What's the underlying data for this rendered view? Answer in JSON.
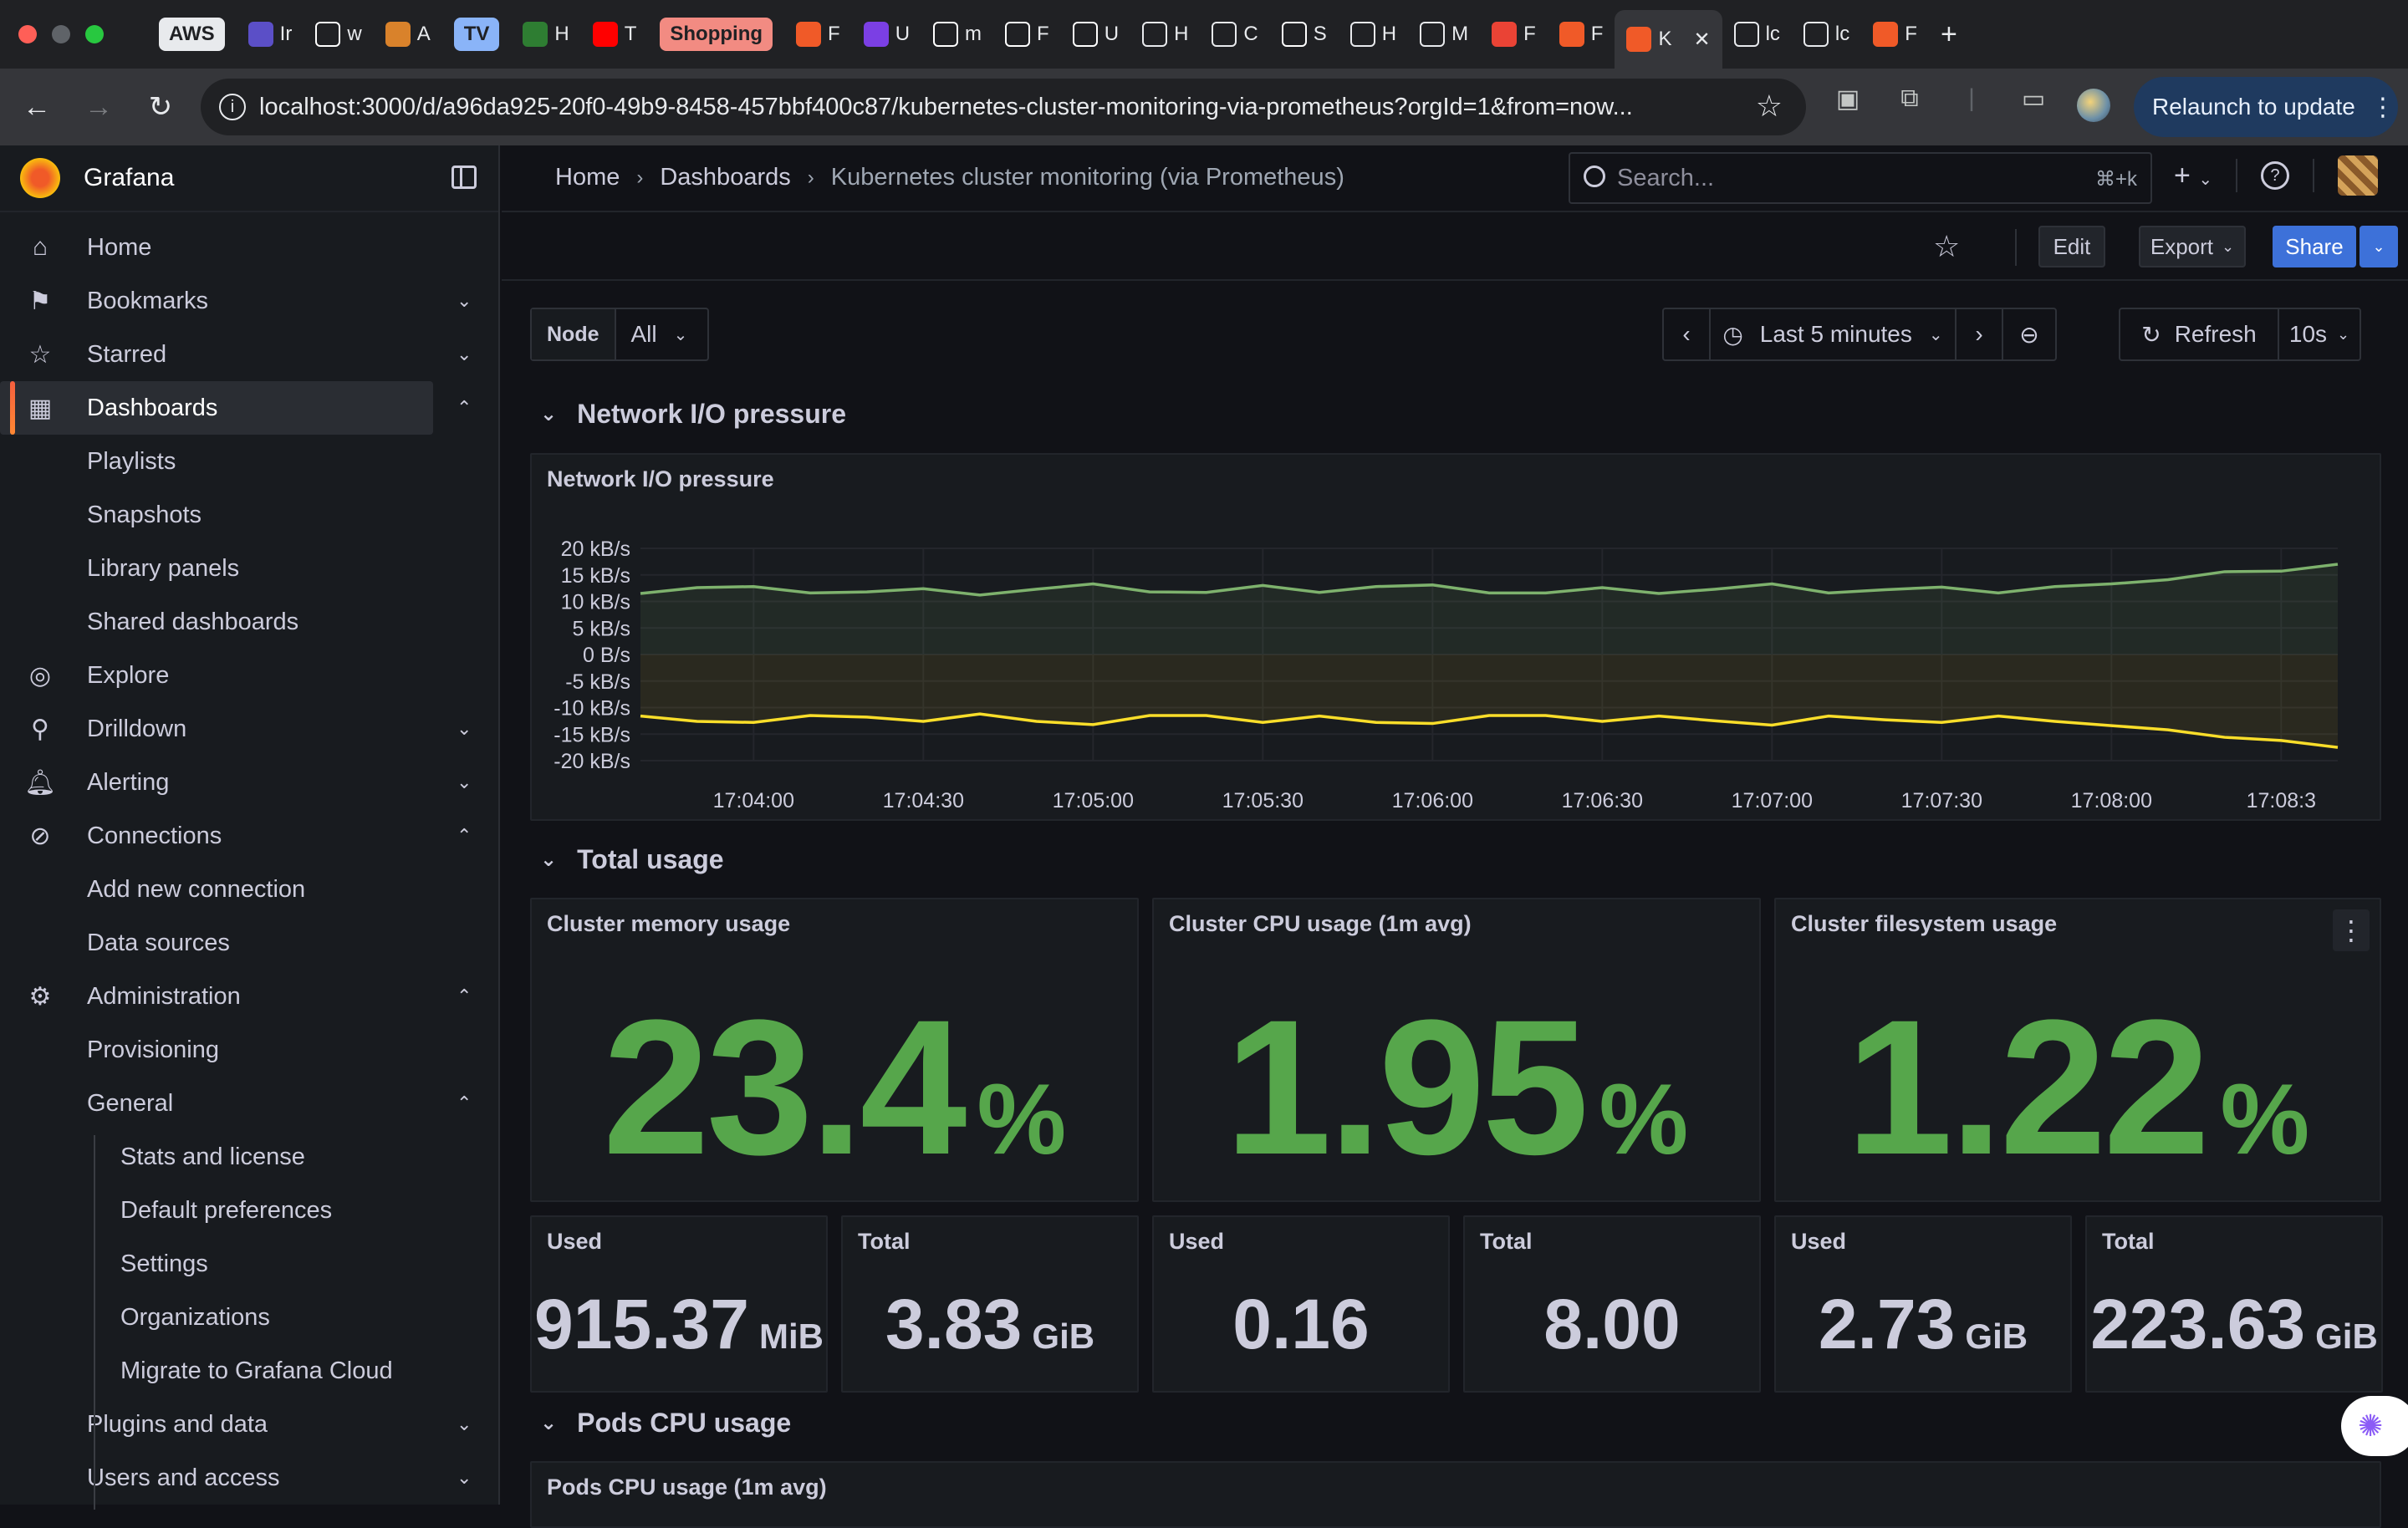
{
  "browser": {
    "tabs": [
      {
        "label": "AWS",
        "kind": "pill",
        "bg": "#e8eaed",
        "fg": "#202124"
      },
      {
        "label": "Ir",
        "icon": "terminal-icon",
        "color": "#5b4fc7"
      },
      {
        "label": "w",
        "icon": "github-icon",
        "color": "#ffffff"
      },
      {
        "label": "A",
        "icon": "app-icon",
        "color": "#d9822b"
      },
      {
        "label": "TV",
        "kind": "pill",
        "bg": "#8ab4f8",
        "fg": "#202124"
      },
      {
        "label": "H",
        "icon": "k-icon",
        "color": "#2e7d32"
      },
      {
        "label": "T",
        "icon": "youtube-icon",
        "color": "#ff0000"
      },
      {
        "label": "Shopping",
        "kind": "pill",
        "bg": "#f28b82",
        "fg": "#202124"
      },
      {
        "label": "F",
        "icon": "gear-icon",
        "color": "#f05a28"
      },
      {
        "label": "U",
        "icon": "u-icon",
        "color": "#7b3fe4"
      },
      {
        "label": "m",
        "icon": "fsu-icon",
        "color": "#ffffff"
      },
      {
        "label": "F",
        "icon": "circle-icon",
        "color": "#ffffff"
      },
      {
        "label": "U",
        "icon": "fsu-icon",
        "color": "#ffffff"
      },
      {
        "label": "H",
        "icon": "globe-icon",
        "color": "#e8eaed"
      },
      {
        "label": "C",
        "icon": "globe-icon",
        "color": "#e8eaed"
      },
      {
        "label": "S",
        "icon": "fsu-icon",
        "color": "#ffffff"
      },
      {
        "label": "H",
        "icon": "globe-icon",
        "color": "#e8eaed"
      },
      {
        "label": "M",
        "icon": "globe-icon",
        "color": "#e8eaed"
      },
      {
        "label": "F",
        "icon": "gmail-icon",
        "color": "#ea4335"
      },
      {
        "label": "F",
        "icon": "grafana-icon",
        "color": "#f05a28"
      },
      {
        "label": "K",
        "icon": "grafana-icon",
        "color": "#f05a28",
        "active": true
      },
      {
        "label": "lc",
        "icon": "globe-icon",
        "color": "#e8eaed"
      },
      {
        "label": "lc",
        "icon": "globe-icon",
        "color": "#e8eaed"
      },
      {
        "label": "F",
        "icon": "grafana-icon",
        "color": "#f05a28"
      }
    ],
    "url": "localhost:3000/d/a96da925-20f0-49b9-8458-457bbf400c87/kubernetes-cluster-monitoring-via-prometheus?orgId=1&from=now...",
    "relaunch_label": "Relaunch to update"
  },
  "sidebar": {
    "brand": "Grafana",
    "items": [
      {
        "label": "Home",
        "icon": "home-icon",
        "level": 0,
        "chev": ""
      },
      {
        "label": "Bookmarks",
        "icon": "bookmark-icon",
        "level": 0,
        "chev": "⌄"
      },
      {
        "label": "Starred",
        "icon": "star-icon",
        "level": 0,
        "chev": "⌄"
      },
      {
        "label": "Dashboards",
        "icon": "dashboards-icon",
        "level": 0,
        "chev": "⌃",
        "active": true
      },
      {
        "label": "Playlists",
        "level": 1
      },
      {
        "label": "Snapshots",
        "level": 1
      },
      {
        "label": "Library panels",
        "level": 1
      },
      {
        "label": "Shared dashboards",
        "level": 1
      },
      {
        "label": "Explore",
        "icon": "compass-icon",
        "level": 0,
        "chev": ""
      },
      {
        "label": "Drilldown",
        "icon": "drilldown-icon",
        "level": 0,
        "chev": "⌄"
      },
      {
        "label": "Alerting",
        "icon": "bell-icon",
        "level": 0,
        "chev": "⌄"
      },
      {
        "label": "Connections",
        "icon": "connections-icon",
        "level": 0,
        "chev": "⌃"
      },
      {
        "label": "Add new connection",
        "level": 1
      },
      {
        "label": "Data sources",
        "level": 1
      },
      {
        "label": "Administration",
        "icon": "cog-icon",
        "level": 0,
        "chev": "⌃"
      },
      {
        "label": "Provisioning",
        "level": 1
      },
      {
        "label": "General",
        "level": 1,
        "chev": "⌃"
      },
      {
        "label": "Stats and license",
        "level": 2
      },
      {
        "label": "Default preferences",
        "level": 2
      },
      {
        "label": "Settings",
        "level": 2
      },
      {
        "label": "Organizations",
        "level": 2
      },
      {
        "label": "Migrate to Grafana Cloud",
        "level": 2
      },
      {
        "label": "Plugins and data",
        "level": 1,
        "chev": "⌄"
      },
      {
        "label": "Users and access",
        "level": 1,
        "chev": "⌄"
      }
    ]
  },
  "header": {
    "breadcrumbs": [
      "Home",
      "Dashboards",
      "Kubernetes cluster monitoring (via Prometheus)"
    ],
    "search_placeholder": "Search...",
    "search_shortcut": "⌘+k"
  },
  "toolbar": {
    "edit": "Edit",
    "export": "Export",
    "share": "Share"
  },
  "variables": {
    "node_label": "Node",
    "node_value": "All"
  },
  "time": {
    "range": "Last 5 minutes",
    "refresh_label": "Refresh",
    "interval": "10s"
  },
  "rows": {
    "network": "Network I/O pressure",
    "total": "Total usage",
    "pods": "Pods CPU usage"
  },
  "panels": {
    "network_title": "Network I/O pressure",
    "memory_title": "Cluster memory usage",
    "memory_value": "23.4",
    "memory_unit": "%",
    "cpu_title": "Cluster CPU usage (1m avg)",
    "cpu_value": "1.95",
    "cpu_unit": "%",
    "fs_title": "Cluster filesystem usage",
    "fs_value": "1.22",
    "fs_unit": "%",
    "small": [
      {
        "title": "Used",
        "value": "915.37",
        "unit": "MiB"
      },
      {
        "title": "Total",
        "value": "3.83",
        "unit": "GiB"
      },
      {
        "title": "Used",
        "value": "0.16",
        "unit": ""
      },
      {
        "title": "Total",
        "value": "8.00",
        "unit": ""
      },
      {
        "title": "Used",
        "value": "2.73",
        "unit": "GiB"
      },
      {
        "title": "Total",
        "value": "223.63",
        "unit": "GiB"
      }
    ],
    "pods_title": "Pods CPU usage (1m avg)"
  },
  "colors": {
    "stat_green": "#56a64b",
    "rx_line": "#7eb26d",
    "tx_line": "#fade2a",
    "accent": "#3d71d9"
  },
  "chart_data": {
    "type": "line",
    "title": "Network I/O pressure",
    "x": [
      "17:03:40",
      "17:03:50",
      "17:04:00",
      "17:04:10",
      "17:04:20",
      "17:04:30",
      "17:04:40",
      "17:04:50",
      "17:05:00",
      "17:05:10",
      "17:05:20",
      "17:05:30",
      "17:05:40",
      "17:05:50",
      "17:06:00",
      "17:06:10",
      "17:06:20",
      "17:06:30",
      "17:06:40",
      "17:06:50",
      "17:07:00",
      "17:07:10",
      "17:07:20",
      "17:07:30",
      "17:07:40",
      "17:07:50",
      "17:08:00",
      "17:08:10",
      "17:08:20",
      "17:08:30",
      "17:08:40"
    ],
    "x_ticks": [
      "17:04:00",
      "17:04:30",
      "17:05:00",
      "17:05:30",
      "17:06:00",
      "17:06:30",
      "17:07:00",
      "17:07:30",
      "17:08:00",
      "17:08:3"
    ],
    "y_ticks": [
      "20 kB/s",
      "15 kB/s",
      "10 kB/s",
      "5 kB/s",
      "0 B/s",
      "-5 kB/s",
      "-10 kB/s",
      "-15 kB/s",
      "-20 kB/s"
    ],
    "ylim": [
      -20,
      20
    ],
    "series": [
      {
        "values": [
          11.5,
          12.6,
          12.8,
          11.6,
          11.8,
          12.4,
          11.2,
          12.3,
          13.3,
          11.8,
          11.7,
          13.0,
          11.7,
          12.8,
          13.1,
          11.6,
          11.6,
          12.6,
          11.5,
          12.3,
          13.3,
          11.6,
          12.2,
          12.7,
          11.6,
          12.8,
          13.3,
          14.1,
          15.6,
          15.7,
          17.0
        ]
      },
      {
        "values": [
          -11.6,
          -12.6,
          -12.8,
          -11.5,
          -11.8,
          -12.6,
          -11.2,
          -12.6,
          -13.2,
          -11.5,
          -11.5,
          -12.8,
          -11.6,
          -12.8,
          -13.0,
          -11.5,
          -11.5,
          -12.6,
          -11.6,
          -12.5,
          -13.3,
          -11.6,
          -12.3,
          -12.8,
          -11.6,
          -12.6,
          -13.4,
          -14.2,
          -15.6,
          -16.2,
          -17.5
        ]
      }
    ]
  }
}
